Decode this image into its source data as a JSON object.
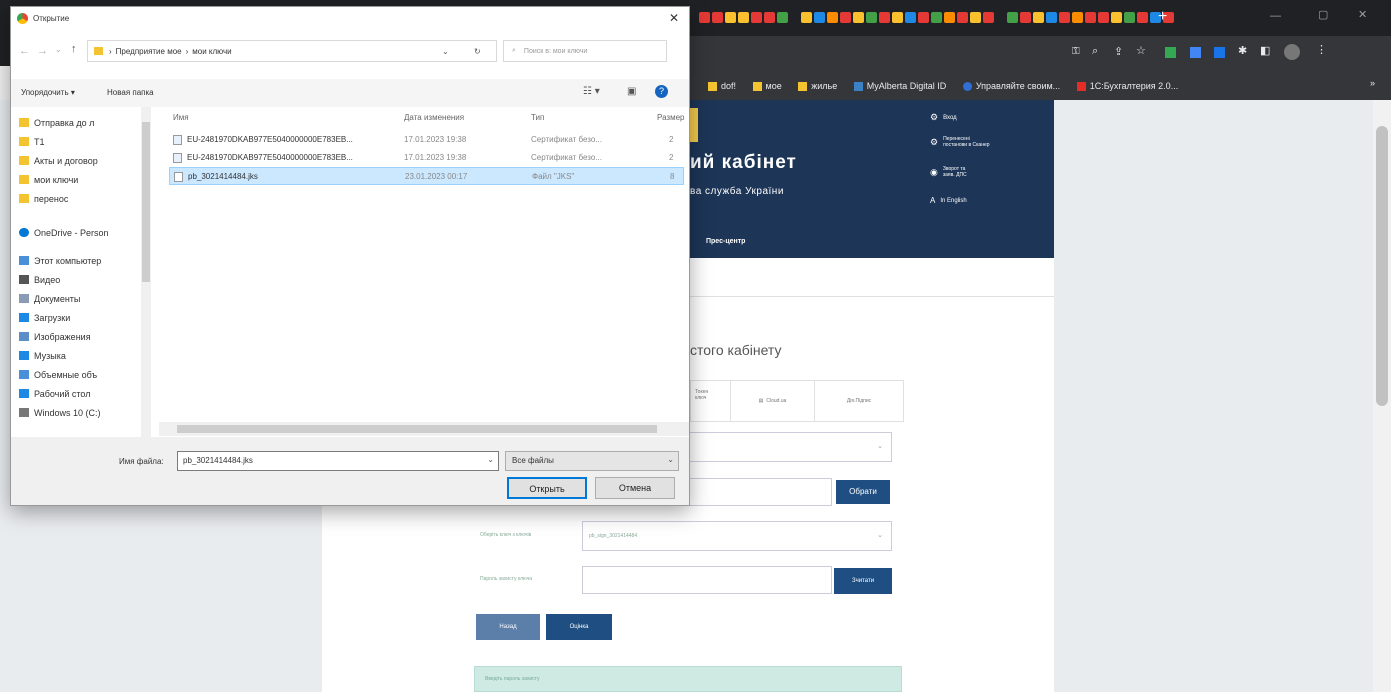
{
  "dialog": {
    "title": "Открытие",
    "path_segments": [
      "Предприятие мое",
      "мои ключи"
    ],
    "path_sep": "›",
    "search_placeholder": "Поиск в: мои ключи",
    "organize": "Упорядочить ▾",
    "new_folder": "Новая папка",
    "nav_items": [
      {
        "label": "Отправка до л",
        "icon": "folder-icon"
      },
      {
        "label": "Т1",
        "icon": "folder-icon"
      },
      {
        "label": "Акты и договор",
        "icon": "folder-icon"
      },
      {
        "label": "мои ключи",
        "icon": "folder-icon"
      },
      {
        "label": "перенос",
        "icon": "folder-icon"
      },
      {
        "label": "OneDrive - Person",
        "icon": "cloud-icon"
      },
      {
        "label": "Этот компьютер",
        "icon": "computer-icon"
      },
      {
        "label": "Видео",
        "icon": "video-icon"
      },
      {
        "label": "Документы",
        "icon": "documents-icon"
      },
      {
        "label": "Загрузки",
        "icon": "downloads-icon"
      },
      {
        "label": "Изображения",
        "icon": "images-icon"
      },
      {
        "label": "Музыка",
        "icon": "music-icon"
      },
      {
        "label": "Объемные объ",
        "icon": "3d-objects-icon"
      },
      {
        "label": "Рабочий стол",
        "icon": "desktop-icon"
      },
      {
        "label": "Windows 10 (C:)",
        "icon": "drive-icon"
      }
    ],
    "columns": [
      "Имя",
      "Дата изменения",
      "Тип",
      "Размер"
    ],
    "files": [
      {
        "name": "EU-2481970DKAB977E5040000000E783EB...",
        "date": "17.01.2023 19:38",
        "type": "Сертификат безо...",
        "size": "2"
      },
      {
        "name": "EU-2481970DKAB977E5040000000E783EB...",
        "date": "17.01.2023 19:38",
        "type": "Сертификат безо...",
        "size": "2"
      },
      {
        "name": "pb_3021414484.jks",
        "date": "23.01.2023 00:17",
        "type": "Файл \"JKS\"",
        "size": "8"
      }
    ],
    "filename_label": "Имя файла:",
    "filename_value": "pb_3021414484.jks",
    "filetype_value": "Все файлы",
    "open_label": "Открыть",
    "cancel_label": "Отмена"
  },
  "browser": {
    "bookmarks": [
      "dof!",
      "мое",
      "жилье",
      "MyAlberta Digital ID",
      "Управляйте своим...",
      "1С:Бухгалтерия 2.0..."
    ]
  },
  "site": {
    "header_title": "ий кабінет",
    "header_subtitle": "ва служба України",
    "header_links": [
      "Вход",
      "Перенесені\nпостанови в Сканер",
      "Зворот та\nзаяв. ДПС",
      "In English"
    ],
    "nav_item": "Прес-центр",
    "section_title": "стого кабінету",
    "tabs": [
      "Токен\nключ",
      "Cloud.ua",
      "Дія.Підпис"
    ],
    "file_button": "Обрати",
    "key_label": "Оберіть ключ з ключів",
    "key_value": "pb_sign_3021414484",
    "password_label": "Пароль захисту ключа",
    "read_button": "Зчитати",
    "action1": "Назад",
    "action2": "Оцінка",
    "notice": "Введіть пароль захисту"
  }
}
